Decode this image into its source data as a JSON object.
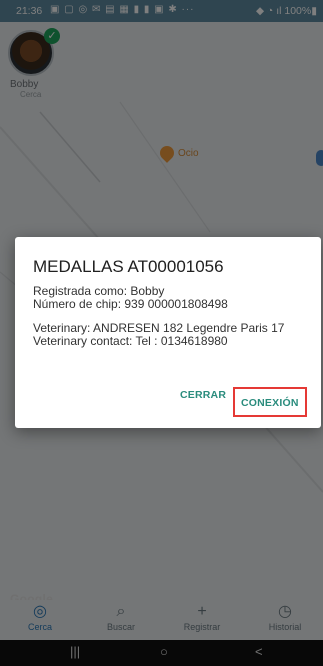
{
  "status_bar": {
    "time": "21:36",
    "left_icons": "▣ ▢ ◎ ✉ ▤ ▦ ▮ ▮ ▣ ✱ ···",
    "right_icons": "◆ ◔ ıl 100%▮"
  },
  "map": {
    "pet_name": "Bobby",
    "pet_sub": "Cerca",
    "poi_label": "Ocio",
    "provider": "Google"
  },
  "dialog": {
    "title": "MEDALLAS AT00001056",
    "registered": "Registrada como: Bobby",
    "chip": "Número de chip: 939 000001808498",
    "vet_address": "Veterinary: ANDRESEN  182 Legendre Paris 17",
    "vet_contact": "Veterinary contact: Tel : 0134618980",
    "close_label": "CERRAR",
    "connect_label": "CONEXIÓN"
  },
  "bottom_nav": {
    "items": [
      {
        "label": "Cerca",
        "icon": "locate-icon"
      },
      {
        "label": "Buscar",
        "icon": "search-icon"
      },
      {
        "label": "Registrar",
        "icon": "plus-icon"
      },
      {
        "label": "Historial",
        "icon": "history-icon"
      }
    ]
  },
  "system_nav": {
    "recent": "|||",
    "home": "○",
    "back": "<"
  },
  "colors": {
    "accent": "#2a8c7d",
    "highlight_box": "#e53935",
    "status_bar": "#5e8aa0"
  }
}
